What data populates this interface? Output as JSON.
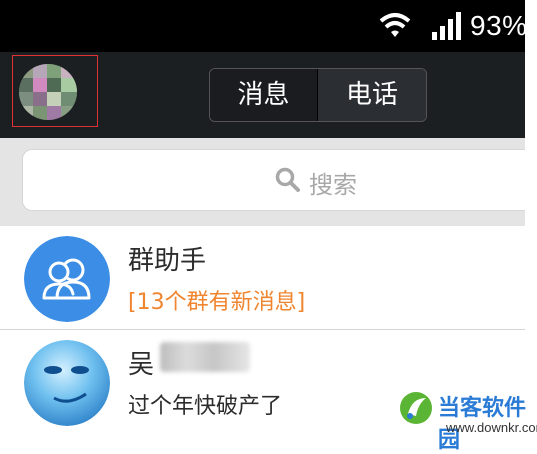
{
  "status_bar": {
    "battery": "93%",
    "wifi_icon": "wifi-icon",
    "signal_icon": "signal-icon"
  },
  "top_bar": {
    "avatar_icon": "profile-avatar",
    "tabs": [
      {
        "label": "消息"
      },
      {
        "label": "电话"
      }
    ]
  },
  "search": {
    "placeholder": "搜索",
    "icon": "search-icon"
  },
  "list": [
    {
      "title": "群助手",
      "subtitle": "[13个群有新消息]",
      "avatar": "group-assistant-icon"
    },
    {
      "title": "吴",
      "subtitle": "过个年快破产了",
      "avatar": "contact-avatar"
    }
  ],
  "watermark": {
    "title": "当客软件园",
    "url": "www.downkr.com"
  },
  "colors": {
    "accent_orange": "#f0852f",
    "topbar": "#1c1f22",
    "avatar_blue": "#3b8de6"
  }
}
